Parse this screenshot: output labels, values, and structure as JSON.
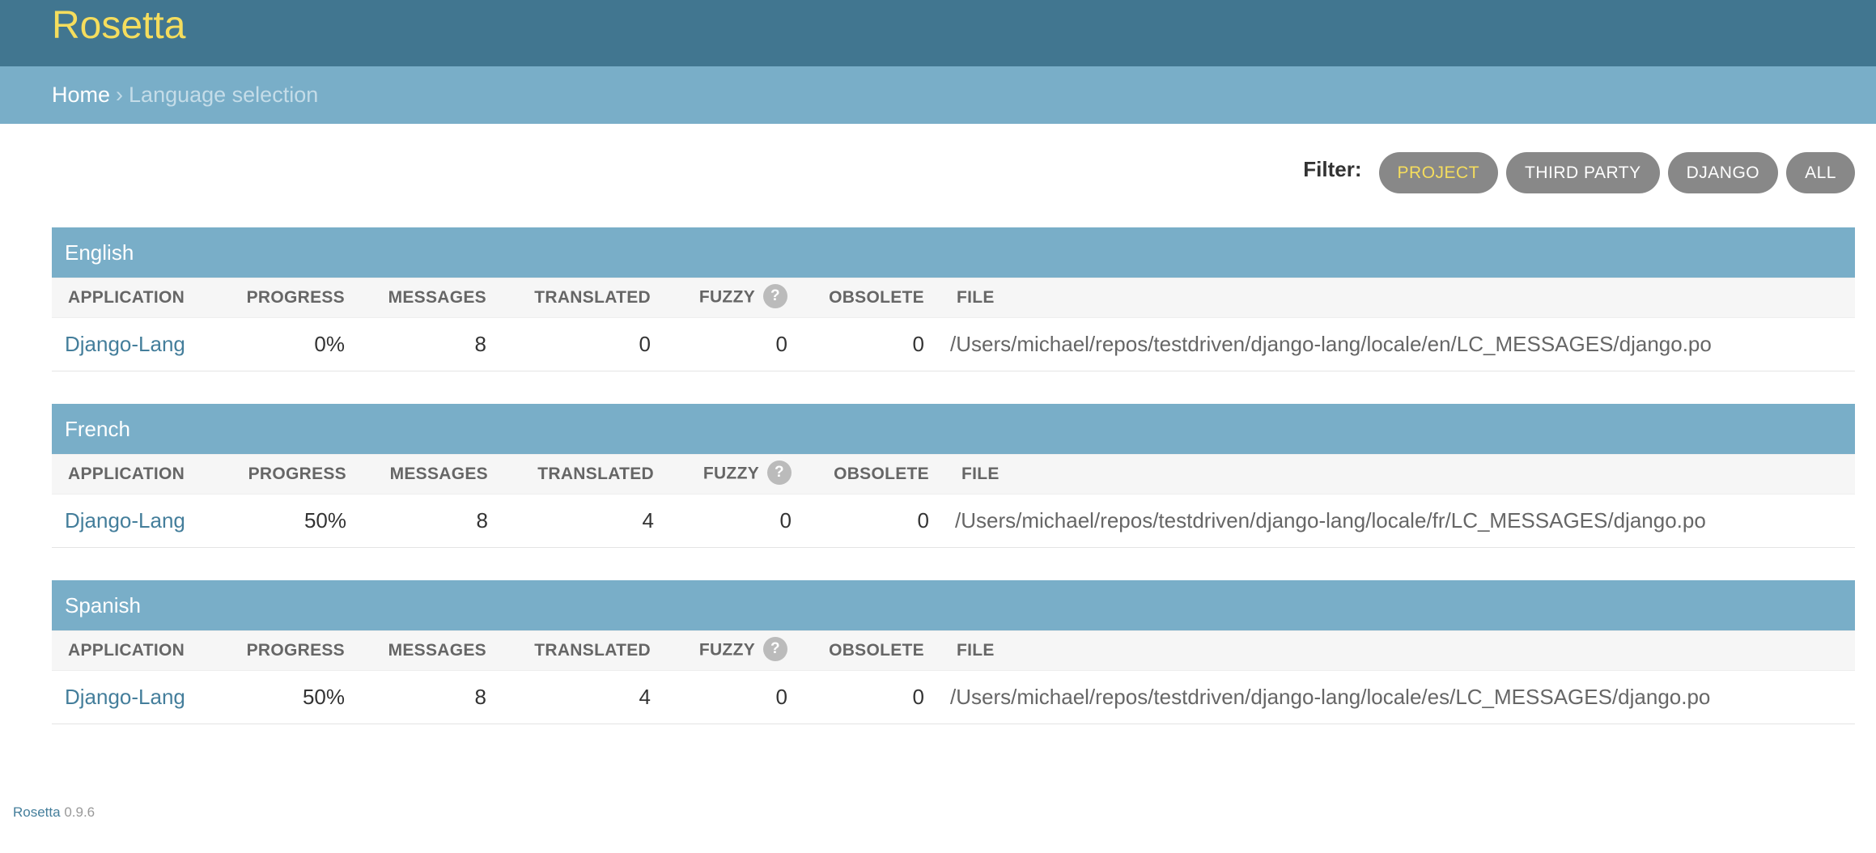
{
  "header": {
    "brand": "Rosetta"
  },
  "breadcrumbs": {
    "home": "Home",
    "separator": "›",
    "current": "Language selection"
  },
  "filter": {
    "label": "Filter:",
    "options": [
      {
        "label": "PROJECT",
        "active": true
      },
      {
        "label": "THIRD PARTY",
        "active": false
      },
      {
        "label": "DJANGO",
        "active": false
      },
      {
        "label": "ALL",
        "active": false
      }
    ]
  },
  "table_headers": {
    "application": "APPLICATION",
    "progress": "PROGRESS",
    "messages": "MESSAGES",
    "translated": "TRANSLATED",
    "fuzzy": "FUZZY",
    "help_icon": "?",
    "obsolete": "OBSOLETE",
    "file": "FILE"
  },
  "languages": [
    {
      "name": "English",
      "rows": [
        {
          "application": "Django-Lang",
          "progress": "0%",
          "messages": "8",
          "translated": "0",
          "fuzzy": "0",
          "obsolete": "0",
          "file": "/Users/michael/repos/testdriven/django-lang/locale/en/LC_MESSAGES/django.po"
        }
      ]
    },
    {
      "name": "French",
      "rows": [
        {
          "application": "Django-Lang",
          "progress": "50%",
          "messages": "8",
          "translated": "4",
          "fuzzy": "0",
          "obsolete": "0",
          "file": "/Users/michael/repos/testdriven/django-lang/locale/fr/LC_MESSAGES/django.po"
        }
      ]
    },
    {
      "name": "Spanish",
      "rows": [
        {
          "application": "Django-Lang",
          "progress": "50%",
          "messages": "8",
          "translated": "4",
          "fuzzy": "0",
          "obsolete": "0",
          "file": "/Users/michael/repos/testdriven/django-lang/locale/es/LC_MESSAGES/django.po"
        }
      ]
    }
  ],
  "footer": {
    "app": "Rosetta",
    "version": "0.9.6"
  },
  "colors": {
    "header_bg": "#417690",
    "brand": "#f5dd5d",
    "breadcrumb_bg": "#79aec8",
    "link": "#447e9b",
    "filter_button": "#888888"
  }
}
